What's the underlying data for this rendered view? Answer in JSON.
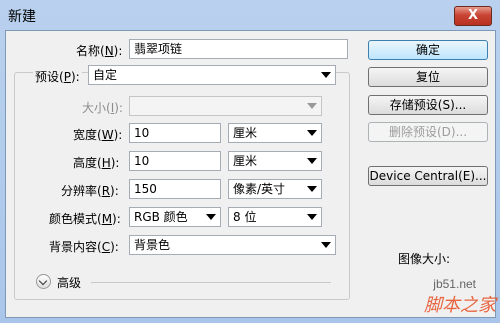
{
  "window": {
    "title": "新建",
    "close_glyph": "X"
  },
  "form": {
    "name": {
      "label": "名称(",
      "key": "N",
      "suffix": "):",
      "value": "翡翠项链"
    },
    "preset": {
      "label": "预设(",
      "key": "P",
      "suffix": "):",
      "value": "自定"
    },
    "size": {
      "label": "大小(",
      "key": "I",
      "suffix": "):",
      "value": ""
    },
    "width": {
      "label": "宽度(",
      "key": "W",
      "suffix": "):",
      "value": "10",
      "unit": "厘米"
    },
    "height": {
      "label": "高度(",
      "key": "H",
      "suffix": "):",
      "value": "10",
      "unit": "厘米"
    },
    "resolution": {
      "label": "分辨率(",
      "key": "R",
      "suffix": "):",
      "value": "150",
      "unit": "像素/英寸"
    },
    "color_mode": {
      "label": "颜色模式(",
      "key": "M",
      "suffix": "):",
      "mode": "RGB 颜色",
      "depth": "8 位"
    },
    "background": {
      "label": "背景内容(",
      "key": "C",
      "suffix": "):",
      "value": "背景色"
    },
    "advanced": {
      "label": "高级"
    }
  },
  "buttons": {
    "ok": "确定",
    "reset": "复位",
    "save_preset": "存储预设(S)...",
    "delete_preset": "删除预设(D)...",
    "device_central": "Device Central(E)..."
  },
  "image_size_label": "图像大小:",
  "watermark": {
    "site": "jb51.net",
    "brand": "脚本之家"
  }
}
